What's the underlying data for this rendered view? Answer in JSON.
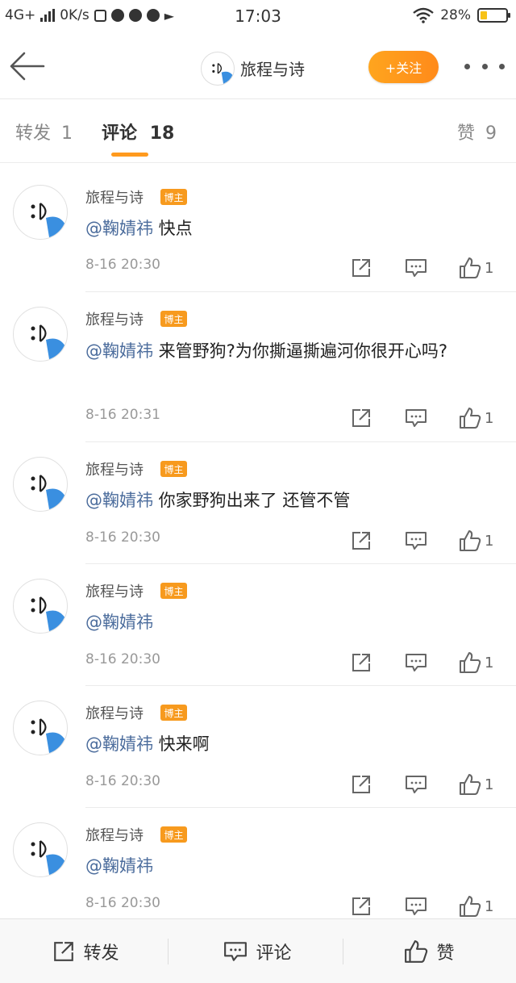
{
  "status_bar": {
    "network": "4G+",
    "speed": "0K/s",
    "time": "17:03",
    "battery": "28%",
    "battery_level": 0.28
  },
  "header": {
    "title": "旅程与诗",
    "follow_label": "+关注"
  },
  "tabs": {
    "repost_label": "转发",
    "repost_count": "1",
    "comment_label": "评论",
    "comment_count": "18",
    "like_label": "赞",
    "like_count": "9"
  },
  "comments": [
    {
      "author": "旅程与诗",
      "badge": "博主",
      "mention": "@鞠婧祎",
      "text": " 快点",
      "time": "8-16 20:30",
      "likes": "1"
    },
    {
      "author": "旅程与诗",
      "badge": "博主",
      "mention": "@鞠婧祎",
      "text": " 来管野狗?为你撕逼撕遍河你很开心吗?",
      "time": "8-16 20:31",
      "likes": "1"
    },
    {
      "author": "旅程与诗",
      "badge": "博主",
      "mention": "@鞠婧祎",
      "text": " 你家野狗出来了 还管不管",
      "time": "8-16 20:30",
      "likes": "1"
    },
    {
      "author": "旅程与诗",
      "badge": "博主",
      "mention": "@鞠婧祎",
      "text": "",
      "time": "8-16 20:30",
      "likes": "1"
    },
    {
      "author": "旅程与诗",
      "badge": "博主",
      "mention": "@鞠婧祎",
      "text": " 快来啊",
      "time": "8-16 20:30",
      "likes": "1"
    },
    {
      "author": "旅程与诗",
      "badge": "博主",
      "mention": "@鞠婧祎",
      "text": "",
      "time": "8-16 20:30",
      "likes": "1"
    }
  ],
  "bottom_bar": {
    "repost_label": "转发",
    "comment_label": "评论",
    "like_label": "赞"
  }
}
